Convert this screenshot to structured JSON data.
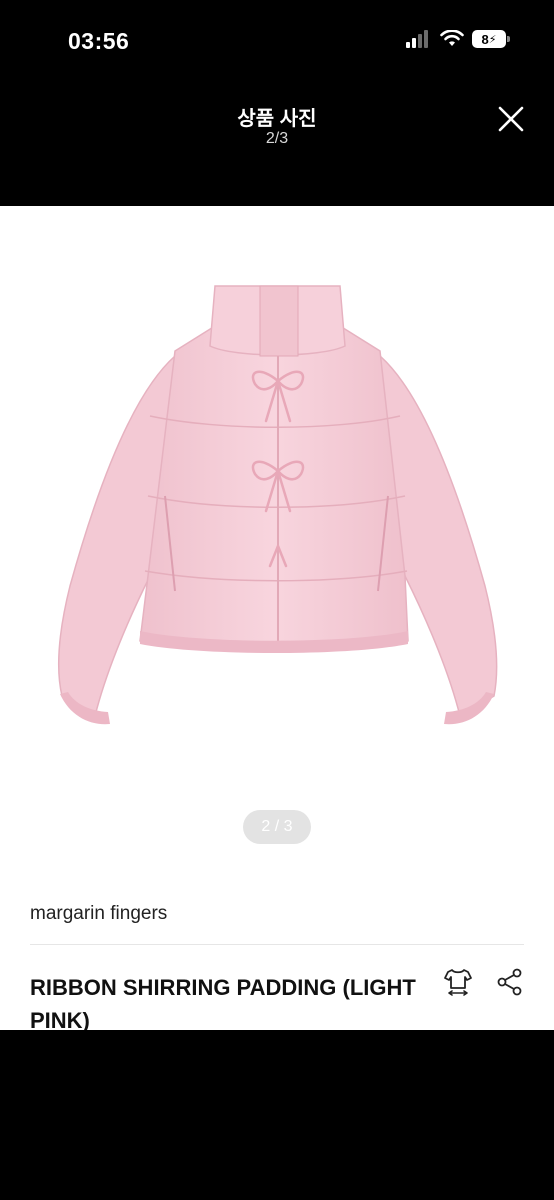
{
  "status_bar": {
    "time": "03:56",
    "battery": "8",
    "icons": [
      "signal-icon",
      "wifi-icon",
      "battery-charging-icon"
    ]
  },
  "header": {
    "title": "상품 사진",
    "counter": "2/3",
    "close_icon": "close-icon"
  },
  "gallery": {
    "image_subject": "light pink puffer jacket with ribbon ties",
    "pager": "2 / 3"
  },
  "product": {
    "brand": "margarin fingers",
    "name": "RIBBON SHIRRING PADDING (LIGHT PINK)",
    "actions": [
      "size-guide-icon",
      "share-icon"
    ]
  },
  "colors": {
    "background": "#000000",
    "content": "#ffffff",
    "jacket": "#f6cfd9"
  }
}
